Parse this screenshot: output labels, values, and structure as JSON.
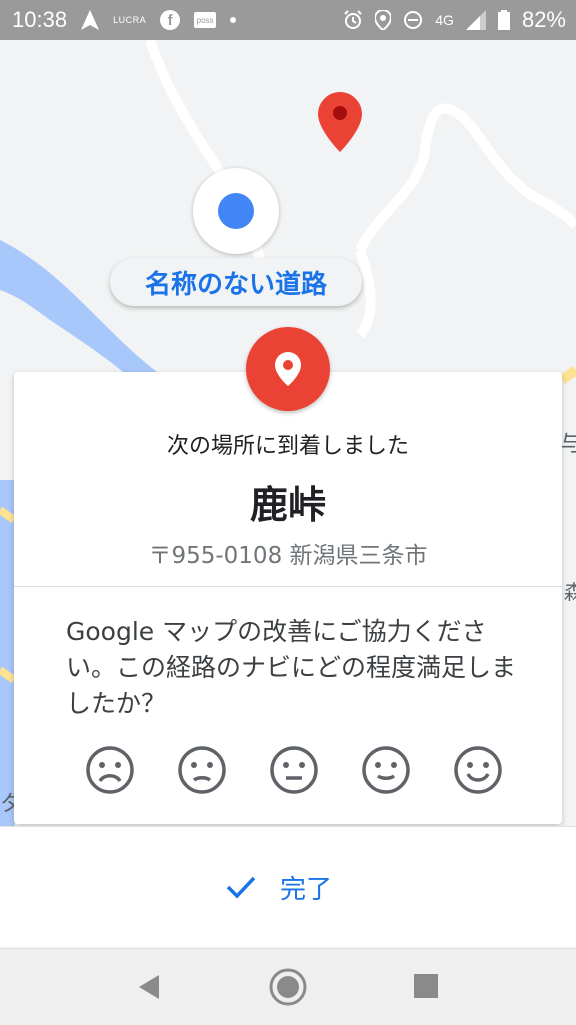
{
  "status_bar": {
    "time": "10:38",
    "app_badge_1": "LUCRA",
    "app_badge_2": "poss",
    "network": "4G",
    "battery": "82%"
  },
  "map": {
    "road_label": "名称のない道路",
    "right_edge_labels": [
      "与",
      "森"
    ],
    "left_edge_label": "タ"
  },
  "arrival_card": {
    "heading": "次の場所に到着しました",
    "place_name": "鹿峠",
    "address": "〒955-0108 新潟県三条市",
    "survey_prompt": "Google マップの改善にご協力ください。この経路のナビにどの程度満足しましたか？",
    "ratings": [
      "very-dissatisfied",
      "dissatisfied",
      "neutral",
      "satisfied",
      "very-satisfied"
    ]
  },
  "bottom_sheet": {
    "done_label": "完了"
  },
  "colors": {
    "accent_blue": "#1a73e8",
    "pin_red": "#ea4335",
    "water": "#a8c7fa",
    "status_bar": "#9a9a9a"
  }
}
